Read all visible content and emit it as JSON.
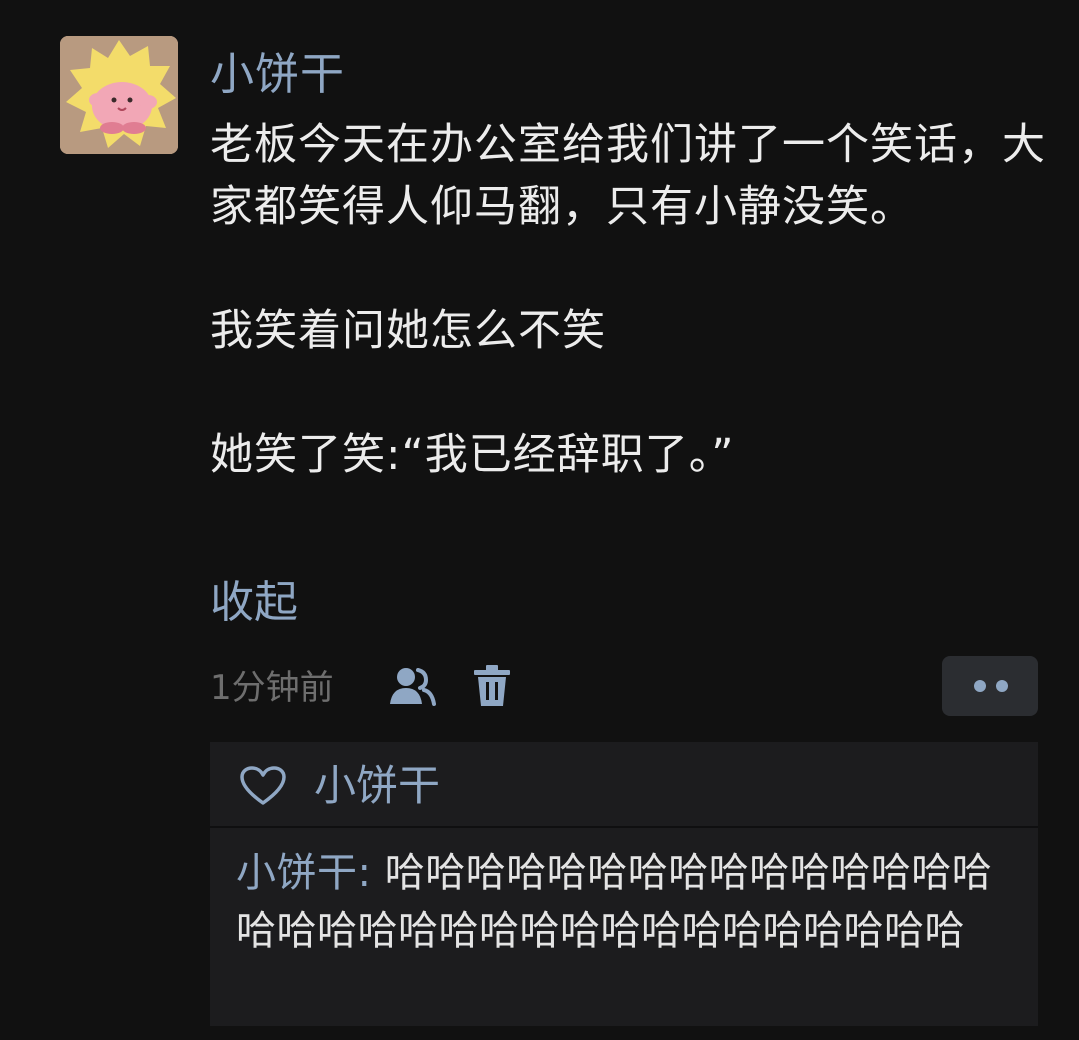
{
  "post": {
    "author_name": "小饼干",
    "avatar_icon": "cartoon-pink-character-avatar",
    "paragraphs": [
      "老板今天在办公室给我们讲了一个笑话，大家都笑得人仰马翻，只有小静没笑。",
      "我笑着问她怎么不笑",
      "她笑了笑:“我已经辞职了。”"
    ],
    "collapse_label": "收起",
    "timestamp": "1分钟前",
    "visibility_icon": "person-visibility-icon",
    "delete_icon": "trash-icon",
    "more_icon": "more-dots-icon"
  },
  "likes": {
    "icon": "heart-icon",
    "names": "小饼干"
  },
  "comments": [
    {
      "author": "小饼干",
      "separator": ": ",
      "text": "哈哈哈哈哈哈哈哈哈哈哈哈哈哈哈哈哈哈哈哈哈哈哈哈哈哈哈哈哈哈哈哈哈"
    }
  ],
  "colors": {
    "background": "#111111",
    "link": "#8fa7c4",
    "panel": "#1c1c1e",
    "muted": "#6e6e6e"
  }
}
